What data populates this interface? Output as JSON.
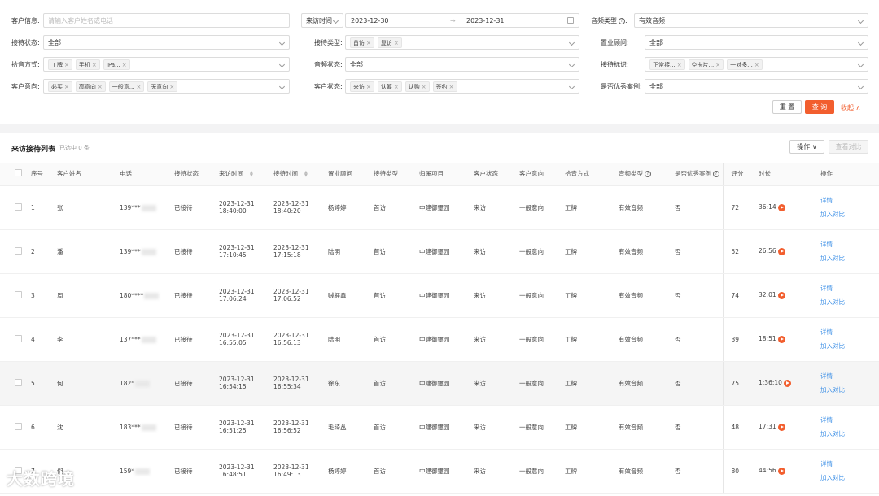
{
  "filters": {
    "customer_info": {
      "label": "客户信息:",
      "placeholder": "请输入客户姓名或电话"
    },
    "visit_time": {
      "label": "来访时间",
      "start": "2023-12-30",
      "sep": "→",
      "end": "2023-12-31"
    },
    "audio_type": {
      "label": "音频类型",
      "q": "?",
      "colon": ":",
      "value": "有效音频"
    },
    "reception_status": {
      "label": "接待状态:",
      "value": "全部"
    },
    "reception_type": {
      "label": "接待类型:",
      "tags": [
        "首访",
        "复访"
      ]
    },
    "consultant": {
      "label": "置业顾问:",
      "value": "全部"
    },
    "pickup_method": {
      "label": "拾音方式:",
      "tags": [
        "工牌",
        "手机",
        "IPa..."
      ]
    },
    "audio_status": {
      "label": "音频状态:",
      "value": "全部"
    },
    "reception_mark": {
      "label": "接待标识:",
      "tags": [
        "正常接...",
        "空卡片...",
        "一对多..."
      ]
    },
    "customer_intent": {
      "label": "客户意向:",
      "tags": [
        "必买",
        "高意向",
        "一般意...",
        "无意向"
      ]
    },
    "customer_status": {
      "label": "客户状态:",
      "tags": [
        "来访",
        "认筹",
        "认购",
        "签约"
      ]
    },
    "excellent_case": {
      "label": "是否优秀案例:",
      "value": "全部"
    },
    "reset_label": "重 置",
    "query_label": "查 询",
    "collapse_label": "收起 ∧"
  },
  "list": {
    "title": "来访接待列表",
    "selected": "已选中 0 条",
    "ops_label": "操作 ∨",
    "compare_label": "查看对比",
    "columns": [
      "序号",
      "客户姓名",
      "电话",
      "接待状态",
      "来访时间",
      "接待时间",
      "置业顾问",
      "接待类型",
      "归属项目",
      "客户状态",
      "客户意向",
      "拾音方式",
      "音频类型",
      "是否优秀案例",
      "评分",
      "时长",
      "操作"
    ],
    "detail_label": "详情",
    "add_compare_label": "加入对比",
    "rows": [
      {
        "no": "1",
        "name": "张",
        "phone": "139***",
        "status": "已接待",
        "visit_date": "2023-12-31",
        "visit_time": "18:40:00",
        "rec_date": "2023-12-31",
        "rec_time": "18:40:20",
        "consultant": "杨婷婷",
        "type": "首访",
        "project": "中建御璽园",
        "cstatus": "来访",
        "intent": "一般意向",
        "pickup": "工牌",
        "audio": "有效音频",
        "excellent": "否",
        "score": "72",
        "duration": "36:14"
      },
      {
        "no": "2",
        "name": "潘",
        "phone": "139***",
        "status": "已接待",
        "visit_date": "2023-12-31",
        "visit_time": "17:10:45",
        "rec_date": "2023-12-31",
        "rec_time": "17:15:18",
        "consultant": "陆明",
        "type": "首访",
        "project": "中建御璽园",
        "cstatus": "来访",
        "intent": "一般意向",
        "pickup": "工牌",
        "audio": "有效音频",
        "excellent": "否",
        "score": "52",
        "duration": "26:56"
      },
      {
        "no": "3",
        "name": "周",
        "phone": "180****",
        "status": "已接待",
        "visit_date": "2023-12-31",
        "visit_time": "17:06:24",
        "rec_date": "2023-12-31",
        "rec_time": "17:06:52",
        "consultant": "贼捱鑫",
        "type": "首访",
        "project": "中建御璽园",
        "cstatus": "来访",
        "intent": "一般意向",
        "pickup": "工牌",
        "audio": "有效音频",
        "excellent": "否",
        "score": "74",
        "duration": "32:01"
      },
      {
        "no": "4",
        "name": "李",
        "phone": "137***",
        "status": "已接待",
        "visit_date": "2023-12-31",
        "visit_time": "16:55:05",
        "rec_date": "2023-12-31",
        "rec_time": "16:56:13",
        "consultant": "陆明",
        "type": "首访",
        "project": "中建御璽园",
        "cstatus": "来访",
        "intent": "一般意向",
        "pickup": "工牌",
        "audio": "有效音频",
        "excellent": "否",
        "score": "39",
        "duration": "18:51"
      },
      {
        "no": "5",
        "name": "何",
        "phone": "182*",
        "status": "已接待",
        "visit_date": "2023-12-31",
        "visit_time": "16:54:15",
        "rec_date": "2023-12-31",
        "rec_time": "16:55:34",
        "consultant": "徐东",
        "type": "首访",
        "project": "中建御璽园",
        "cstatus": "来访",
        "intent": "一般意向",
        "pickup": "工牌",
        "audio": "有效音频",
        "excellent": "否",
        "score": "75",
        "duration": "1:36:10"
      },
      {
        "no": "6",
        "name": "沈",
        "phone": "183***",
        "status": "已接待",
        "visit_date": "2023-12-31",
        "visit_time": "16:51:25",
        "rec_date": "2023-12-31",
        "rec_time": "16:56:52",
        "consultant": "毛绮丛",
        "type": "首访",
        "project": "中建御璽园",
        "cstatus": "来访",
        "intent": "一般意向",
        "pickup": "工牌",
        "audio": "有效音频",
        "excellent": "否",
        "score": "48",
        "duration": "17:31"
      },
      {
        "no": "7",
        "name": "倪",
        "phone": "159*",
        "status": "已接待",
        "visit_date": "2023-12-31",
        "visit_time": "16:48:51",
        "rec_date": "2023-12-31",
        "rec_time": "16:49:13",
        "consultant": "杨婷婷",
        "type": "首访",
        "project": "中建御璽园",
        "cstatus": "来访",
        "intent": "一般意向",
        "pickup": "工牌",
        "audio": "有效音频",
        "excellent": "否",
        "score": "80",
        "duration": "44:56"
      }
    ]
  },
  "watermark": "大数跨境",
  "colors": {
    "accent": "#f25e2e",
    "link": "#3a8ee6"
  }
}
